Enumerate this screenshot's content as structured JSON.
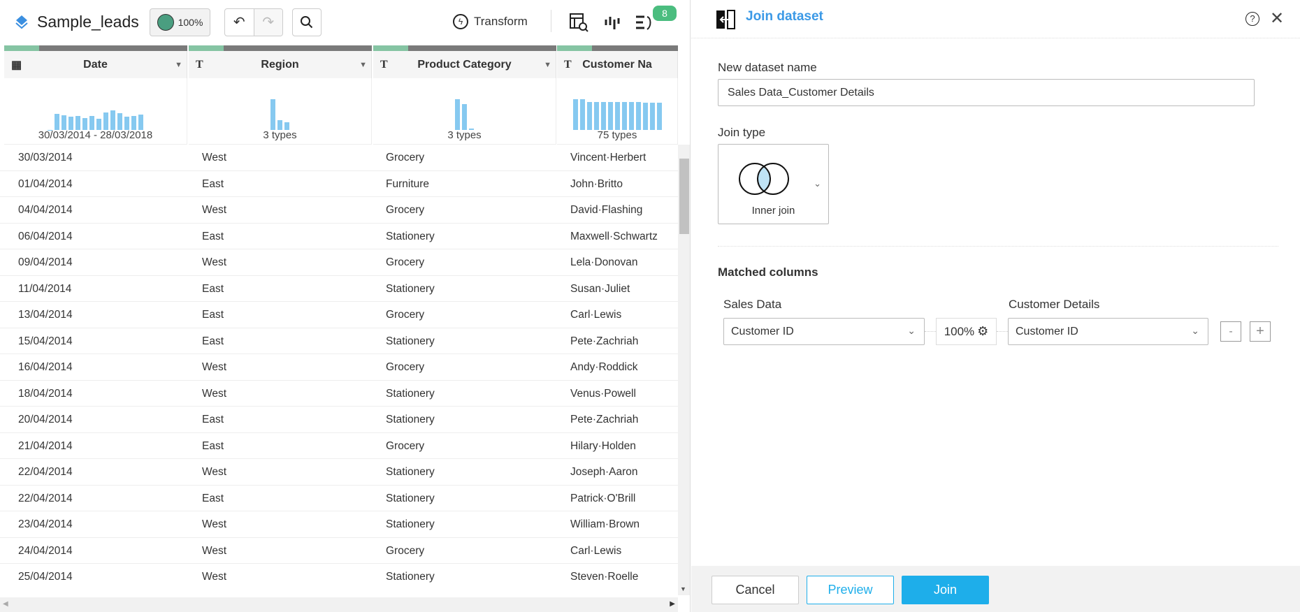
{
  "toolbar": {
    "title": "Sample_leads",
    "quality": "100%",
    "transform": "Transform",
    "badge": "8"
  },
  "columns": [
    {
      "type_icon": "calendar-icon",
      "type_glyph": "▦",
      "name": "Date",
      "summary": "30/03/2014 - 28/03/2018",
      "hist": [
        1,
        52,
        48,
        44,
        46,
        40,
        46,
        36,
        57,
        64,
        55,
        44,
        46,
        50
      ]
    },
    {
      "type_icon": "text-type-icon",
      "type_glyph": "T",
      "name": "Region",
      "summary": "3 types",
      "hist": [
        100,
        32,
        25
      ]
    },
    {
      "type_icon": "text-type-icon",
      "type_glyph": "T",
      "name": "Product Category",
      "summary": "3 types",
      "hist": [
        100,
        86,
        5
      ]
    },
    {
      "type_icon": "text-type-icon",
      "type_glyph": "T",
      "name": "Customer Na",
      "summary": "75 types",
      "hist": [
        100,
        100,
        92,
        92,
        92,
        91,
        91,
        91,
        91,
        91,
        89,
        89,
        89
      ]
    }
  ],
  "rows": [
    [
      "30/03/2014",
      "West",
      "Grocery",
      "Vincent·Herbert"
    ],
    [
      "01/04/2014",
      "East",
      "Furniture",
      "John·Britto"
    ],
    [
      "04/04/2014",
      "West",
      "Grocery",
      "David·Flashing"
    ],
    [
      "06/04/2014",
      "East",
      "Stationery",
      "Maxwell·Schwartz"
    ],
    [
      "09/04/2014",
      "West",
      "Grocery",
      "Lela·Donovan"
    ],
    [
      "11/04/2014",
      "East",
      "Stationery",
      "Susan·Juliet"
    ],
    [
      "13/04/2014",
      "East",
      "Grocery",
      "Carl·Lewis"
    ],
    [
      "15/04/2014",
      "East",
      "Stationery",
      "Pete·Zachriah"
    ],
    [
      "16/04/2014",
      "West",
      "Grocery",
      "Andy·Roddick"
    ],
    [
      "18/04/2014",
      "West",
      "Stationery",
      "Venus·Powell"
    ],
    [
      "20/04/2014",
      "East",
      "Stationery",
      "Pete·Zachriah"
    ],
    [
      "21/04/2014",
      "East",
      "Grocery",
      "Hilary·Holden"
    ],
    [
      "22/04/2014",
      "West",
      "Stationery",
      "Joseph·Aaron"
    ],
    [
      "22/04/2014",
      "East",
      "Stationery",
      "Patrick·O'Brill"
    ],
    [
      "23/04/2014",
      "West",
      "Stationery",
      "William·Brown"
    ],
    [
      "24/04/2014",
      "West",
      "Grocery",
      "Carl·Lewis"
    ],
    [
      "25/04/2014",
      "West",
      "Stationery",
      "Steven·Roelle"
    ]
  ],
  "panel": {
    "title": "Join dataset",
    "name_label": "New dataset name",
    "name_value": "Sales Data_Customer Details",
    "join_type_label": "Join type",
    "join_type": "Inner join",
    "matched_label": "Matched columns",
    "left_ds": "Sales Data",
    "right_ds": "Customer Details",
    "left_col": "Customer ID",
    "right_col": "Customer ID",
    "match_pct": "100%",
    "minus": "-",
    "plus": "+",
    "cancel": "Cancel",
    "preview": "Preview",
    "join": "Join"
  },
  "colors": {
    "accent": "#1eaeea",
    "quality": "#4a9e80",
    "hist": "#86c9f0"
  }
}
